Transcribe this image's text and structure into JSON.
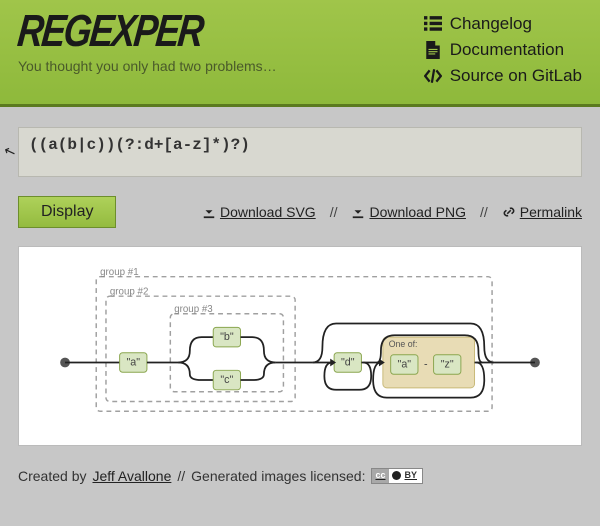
{
  "header": {
    "logo": "REGEXPER",
    "tagline": "You thought you only had two problems…",
    "nav": {
      "changelog": "Changelog",
      "documentation": "Documentation",
      "source": "Source on GitLab"
    }
  },
  "editor": {
    "regex_value": "((a(b|c))(?:d+[a-z]*)?)"
  },
  "toolbar": {
    "display_label": "Display",
    "download_svg": "Download SVG",
    "download_png": "Download PNG",
    "permalink": "Permalink",
    "sep": "//"
  },
  "diagram": {
    "group1": "group #1",
    "group2": "group #2",
    "group3": "group #3",
    "lit_a": "\"a\"",
    "lit_b": "\"b\"",
    "lit_c": "\"c\"",
    "lit_d": "\"d\"",
    "class_label": "One of:",
    "range_from": "\"a\"",
    "range_dash": "-",
    "range_to": "\"z\""
  },
  "footer": {
    "created_prefix": "Created by ",
    "author": "Jeff Avallone",
    "license_sep": " // ",
    "license_prefix": "Generated images licensed: ",
    "cc": "cc",
    "by": "BY"
  }
}
